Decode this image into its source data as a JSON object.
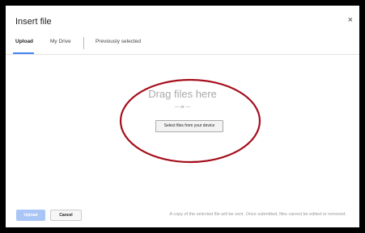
{
  "dialog": {
    "title": "Insert file",
    "close_icon": "close-icon",
    "close_glyph": "×"
  },
  "tabs": [
    {
      "label": "Upload",
      "active": true
    },
    {
      "label": "My Drive",
      "active": false
    },
    {
      "label": "Previously selected",
      "active": false
    }
  ],
  "dropzone": {
    "title": "Drag files here",
    "or_text": "— or —",
    "select_button": "Select files from your device"
  },
  "footer": {
    "upload_button": "Upload",
    "cancel_button": "Cancel",
    "note": "A copy of the selected file will be sent. Once submitted, files cannot be edited or removed."
  },
  "colors": {
    "accent": "#4285f4",
    "annotation": "#a50e1c",
    "upload_disabled": "#a9c6f6"
  }
}
